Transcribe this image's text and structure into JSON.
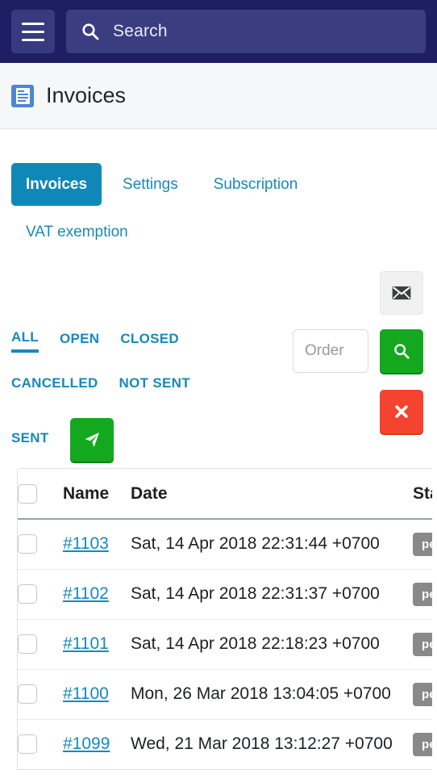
{
  "navbar": {
    "menu_icon": "hamburger-menu-icon",
    "search_icon": "search-icon",
    "search_placeholder": "Search",
    "search_value": "",
    "background_color": "#1e1f62"
  },
  "page_header": {
    "icon": "invoice-document-icon",
    "title": "Invoices",
    "background_color": "#f6f7f8"
  },
  "tabs": [
    {
      "label": "Invoices",
      "active": true
    },
    {
      "label": "Settings",
      "active": false
    },
    {
      "label": "Subscription",
      "active": false
    },
    {
      "label": "VAT exemption",
      "active": false
    }
  ],
  "toolbar": {
    "mail_button_icon": "envelope-icon",
    "order_placeholder": "Order",
    "order_value": "",
    "search_button_icon": "search-icon",
    "clear_button_icon": "close-x-icon",
    "send_button_icon": "paper-plane-icon",
    "accent_color": "#1789bb",
    "green_color": "#14a81e",
    "red_color": "#f4432f"
  },
  "filters": [
    {
      "label": "ALL",
      "active": true
    },
    {
      "label": "OPEN",
      "active": false
    },
    {
      "label": "CLOSED",
      "active": false
    },
    {
      "label": "CANCELLED",
      "active": false
    },
    {
      "label": "NOT SENT",
      "active": false
    },
    {
      "label": "SENT",
      "active": false
    }
  ],
  "table": {
    "columns": [
      "",
      "Name",
      "Date",
      "Status"
    ],
    "rows": [
      {
        "name": "#1103",
        "date": "Sat, 14 Apr 2018 22:31:44 +0700",
        "status": "pending",
        "checked": false
      },
      {
        "name": "#1102",
        "date": "Sat, 14 Apr 2018 22:31:37 +0700",
        "status": "pending",
        "checked": false
      },
      {
        "name": "#1101",
        "date": "Sat, 14 Apr 2018 22:18:23 +0700",
        "status": "pending",
        "checked": false
      },
      {
        "name": "#1100",
        "date": "Mon, 26 Mar 2018 13:04:05 +0700",
        "status": "pending",
        "checked": false
      },
      {
        "name": "#1099",
        "date": "Wed, 21 Mar 2018 13:12:27 +0700",
        "status": "pending",
        "checked": false
      }
    ]
  }
}
